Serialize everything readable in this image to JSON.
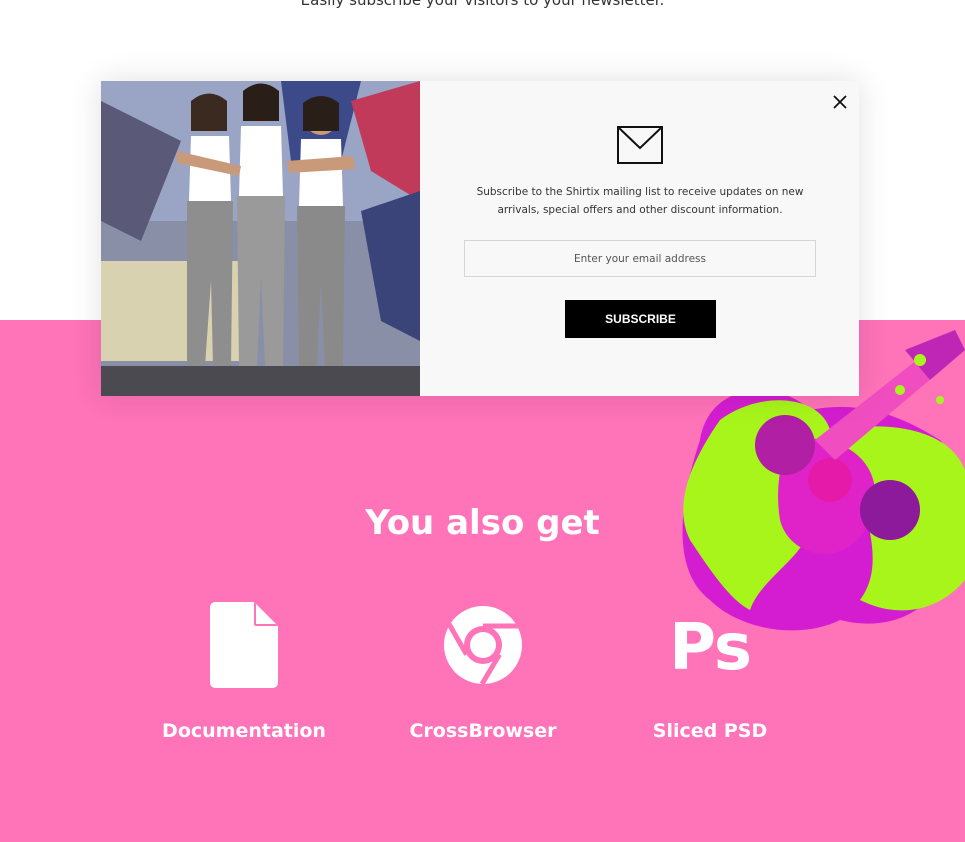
{
  "intro": {
    "text": "Easily subscribe your visitors to your newsletter."
  },
  "popup": {
    "image_alt": "Three women in white tank tops and grey trousers posing in front of a graffiti wall",
    "icon": "mail-envelope-icon",
    "close_icon": "close-icon",
    "description": "Subscribe to the Shirtix mailing list to receive updates on new arrivals, special offers and other discount information.",
    "email_placeholder": "Enter your email address",
    "email_value": "",
    "subscribe_label": "SUBSCRIBE"
  },
  "extras": {
    "title": "You also get",
    "features": [
      {
        "icon": "document-icon",
        "label": "Documentation"
      },
      {
        "icon": "chrome-browser-icon",
        "label": "CrossBrowser"
      },
      {
        "icon": "photoshop-icon",
        "label": "Sliced PSD"
      }
    ]
  },
  "colors": {
    "section_background": "#ff73b9",
    "button_background": "#000000",
    "popup_background": "#f8f8f8",
    "text_white": "#ffffff"
  }
}
